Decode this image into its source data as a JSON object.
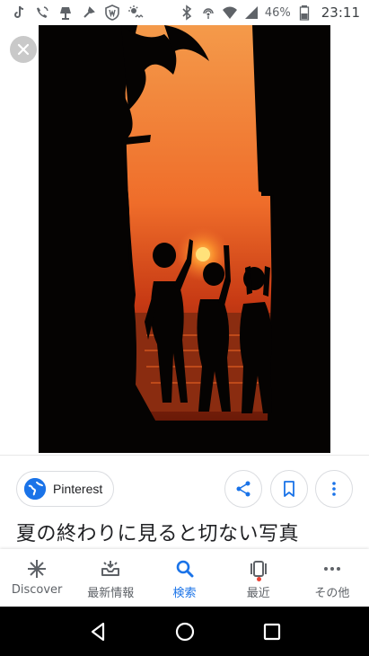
{
  "status_bar": {
    "left_icons": [
      "tiktok-icon",
      "wifi-calling-icon",
      "lamp-icon",
      "tool-icon",
      "shield-icon",
      "weather-icon"
    ],
    "right_icons": [
      "bluetooth-icon",
      "nfc-icon",
      "wifi-icon",
      "signal-icon",
      "battery-icon"
    ],
    "battery": "46%",
    "time": "23:11"
  },
  "viewer": {
    "close_icon": "close-icon",
    "photo_subject": "sunset-silhouette-photo"
  },
  "source": {
    "name": "Pinterest",
    "logo_icon": "globe-icon"
  },
  "actions": {
    "share_icon": "share-icon",
    "save_icon": "bookmark-icon",
    "more_icon": "more-vert-icon"
  },
  "title": "夏の終わりに見ると切ない写真",
  "bottom_nav": {
    "items": [
      {
        "label": "Discover",
        "icon": "asterisk-icon"
      },
      {
        "label": "最新情報",
        "icon": "inbox-icon"
      },
      {
        "label": "検索",
        "icon": "search-icon"
      },
      {
        "label": "最近",
        "icon": "recent-cards-icon"
      },
      {
        "label": "その他",
        "icon": "more-horiz-icon"
      }
    ],
    "active_index": 2
  },
  "system_nav": {
    "back_icon": "back-icon",
    "home_icon": "home-icon",
    "recents_icon": "recents-icon"
  },
  "colors": {
    "accent": "#1a73e8",
    "text_primary": "#202124",
    "text_secondary": "#5f6368",
    "notif": "#ea4335"
  }
}
